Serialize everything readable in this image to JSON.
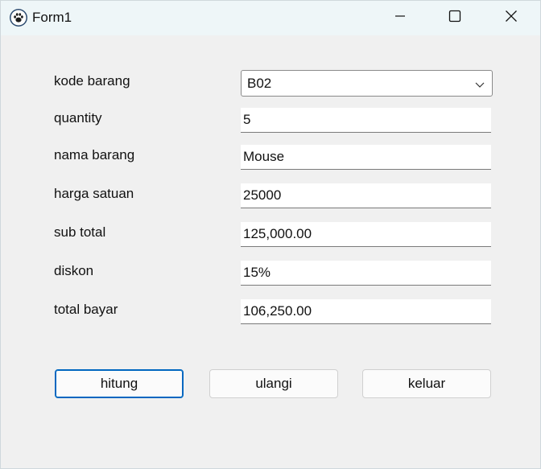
{
  "window": {
    "title": "Form1"
  },
  "icons": {
    "app": "paw-icon",
    "minimize": "minimize-icon",
    "maximize": "maximize-icon",
    "close": "close-icon",
    "dropdown": "chevron-down-icon"
  },
  "form": {
    "kode_barang": {
      "label": "kode barang",
      "value": "B02"
    },
    "quantity": {
      "label": "quantity",
      "value": "5"
    },
    "nama_barang": {
      "label": "nama barang",
      "value": "Mouse"
    },
    "harga_satuan": {
      "label": "harga satuan",
      "value": "25000"
    },
    "sub_total": {
      "label": "sub total",
      "value": "125,000.00"
    },
    "diskon": {
      "label": "diskon",
      "value": "15%"
    },
    "total_bayar": {
      "label": "total bayar",
      "value": "106,250.00"
    }
  },
  "buttons": {
    "hitung": "hitung",
    "ulangi": "ulangi",
    "keluar": "keluar"
  },
  "colors": {
    "accent": "#0067c0",
    "titlebar": "#eef6f8",
    "background": "#f0f0f0"
  }
}
